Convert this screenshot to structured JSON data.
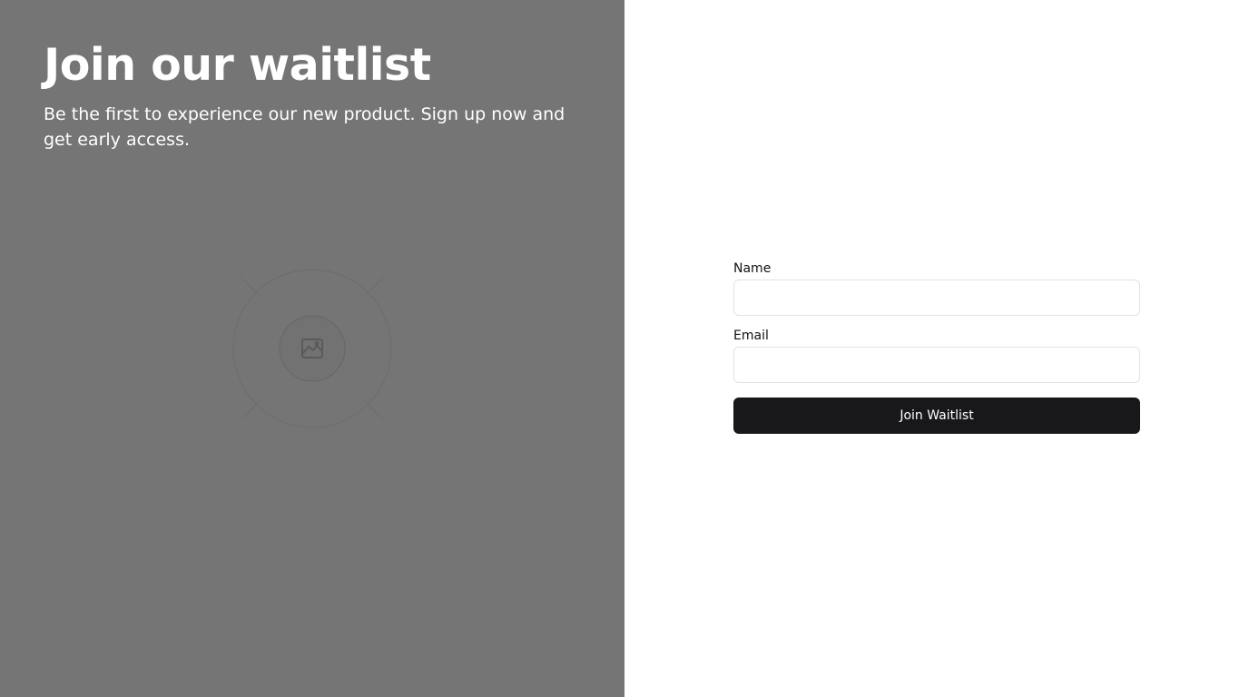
{
  "hero": {
    "title": "Join our waitlist",
    "subtitle": "Be the first to experience our new product. Sign up now and get early access.",
    "background_color": "#757575",
    "image_placeholder_icon": "image-icon"
  },
  "form": {
    "name_label": "Name",
    "name_value": "",
    "email_label": "Email",
    "email_value": "",
    "submit_label": "Join Waitlist",
    "button_color": "#18181b"
  }
}
